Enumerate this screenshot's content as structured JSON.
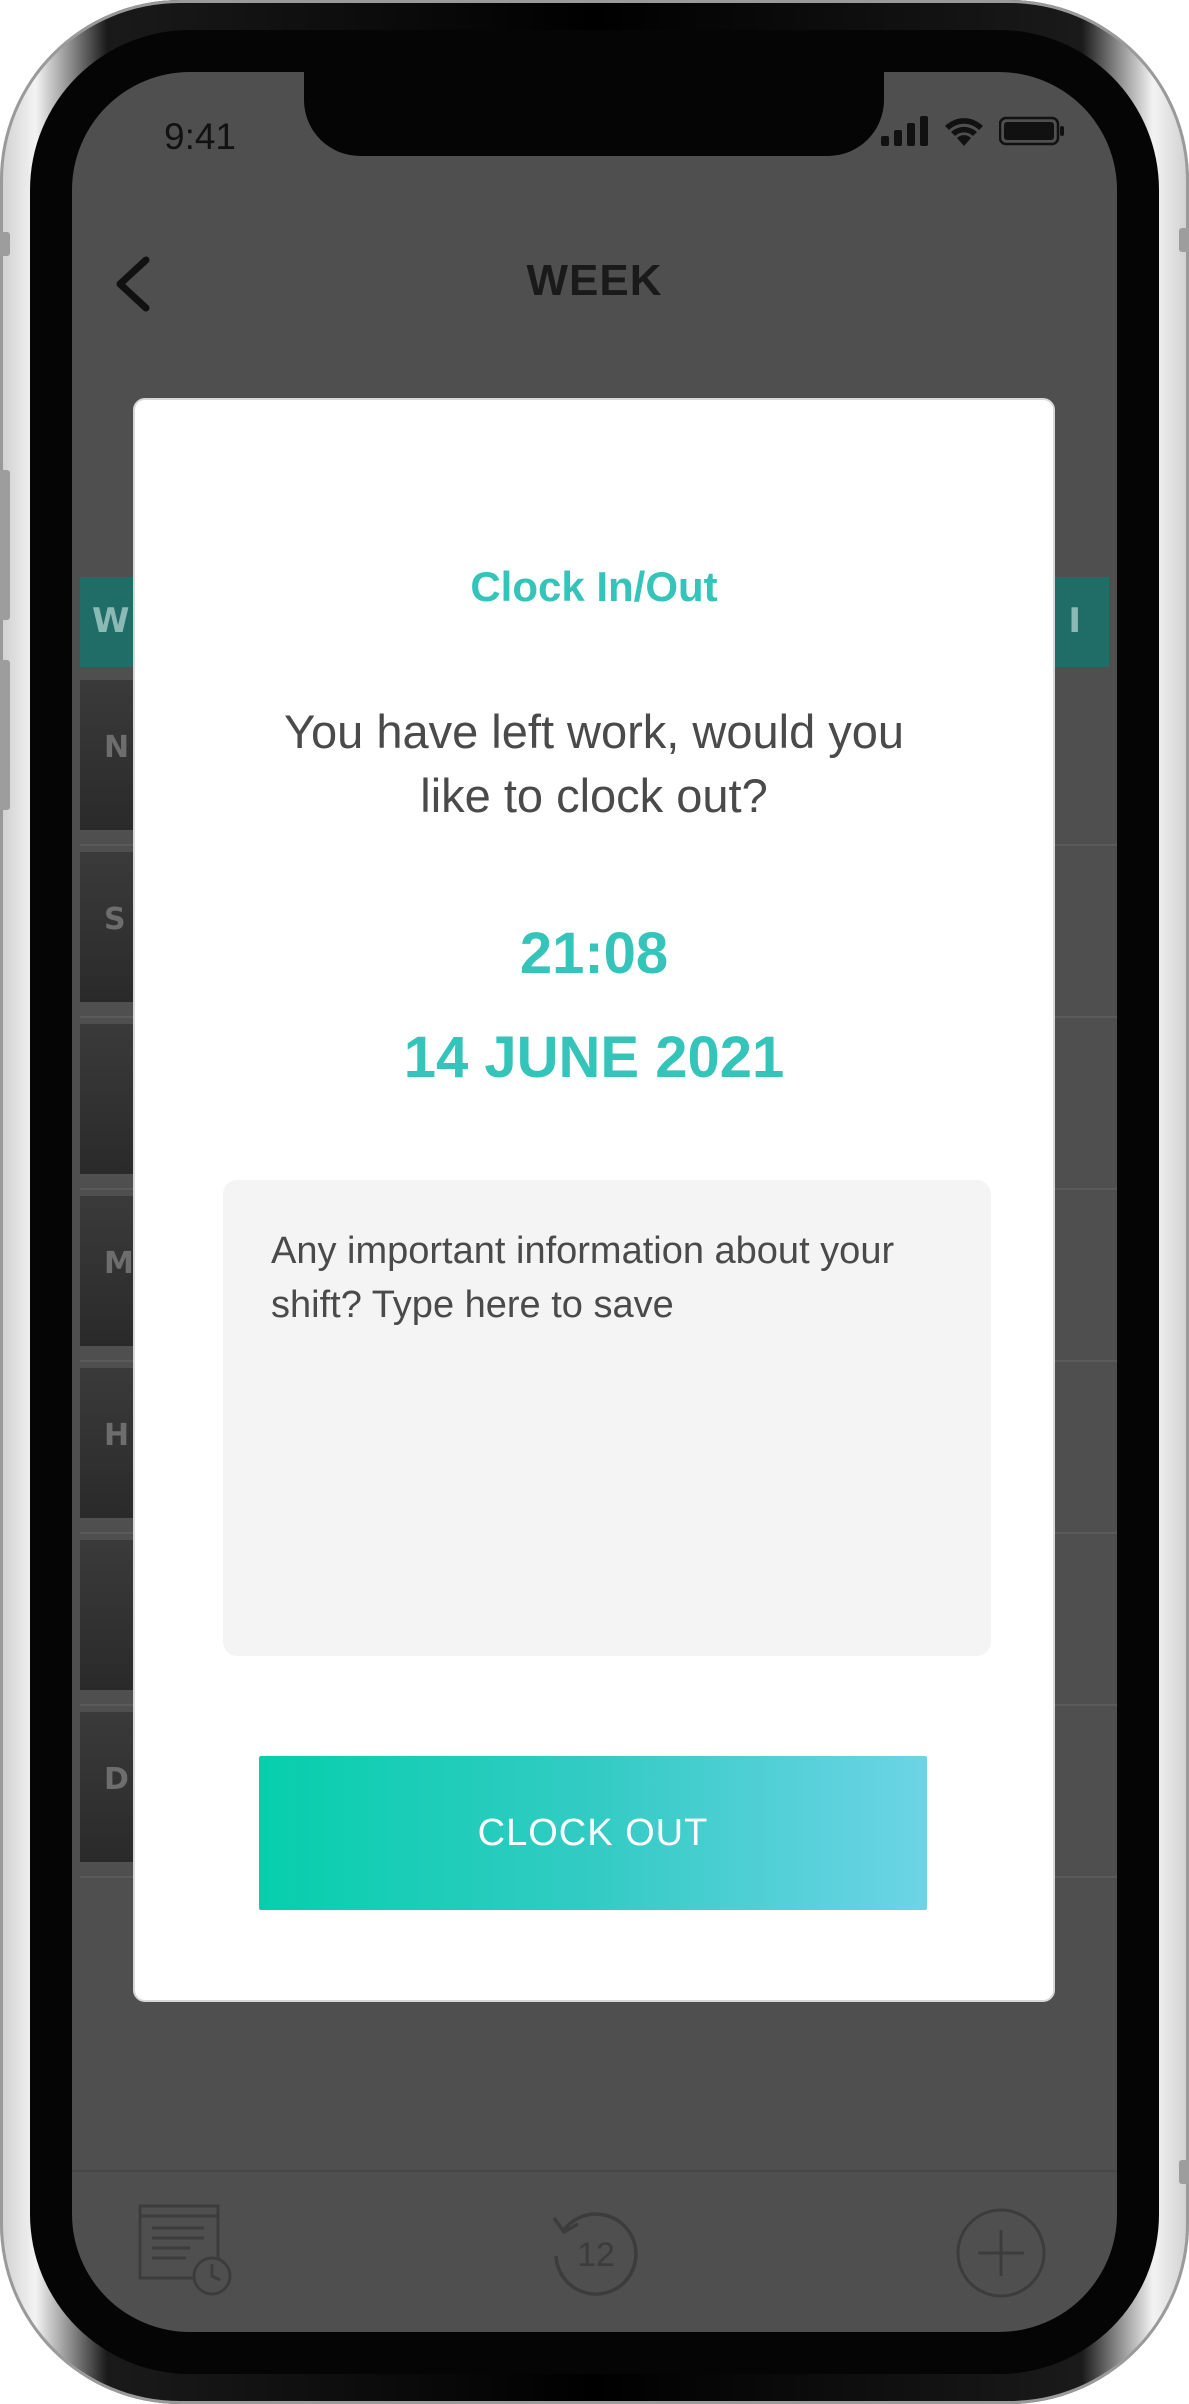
{
  "status_bar": {
    "time": "9:41"
  },
  "nav": {
    "title": "WEEK"
  },
  "background": {
    "header_left": "W",
    "header_right": "I",
    "row_letters": [
      "N",
      "S",
      "",
      "M",
      "H",
      "",
      "D"
    ]
  },
  "modal": {
    "title": "Clock In/Out",
    "message": "You have left work, would you like to clock out?",
    "time": "21:08",
    "date": "14 JUNE 2021",
    "notes_placeholder": "Any important information about your shift? Type here to save",
    "notes_value": "",
    "button_label": "CLOCK OUT"
  },
  "tabbar": {
    "history_number": "12"
  },
  "colors": {
    "accent": "#35c4b9",
    "button_gradient_start": "#06cfac",
    "button_gradient_end": "#6cd4e6",
    "overlay": "#4f4f4f"
  }
}
